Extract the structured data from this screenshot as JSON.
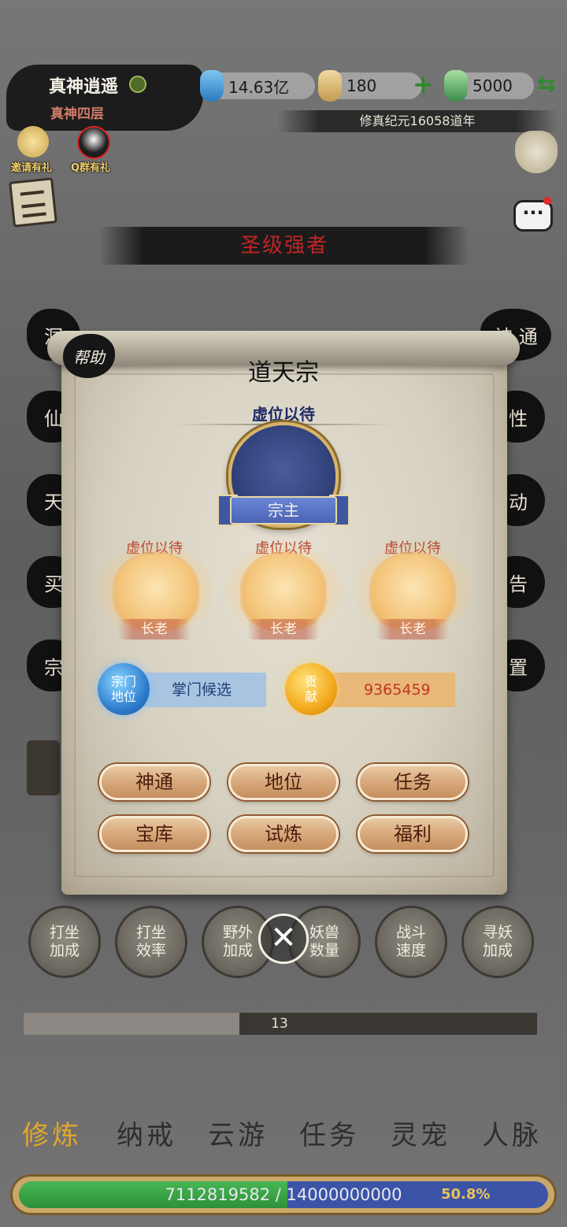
{
  "player": {
    "name": "真神逍遥",
    "level": "真神四层"
  },
  "resources": {
    "spirit_stones": "14.63亿",
    "gourd": "180",
    "add_symbol": "+",
    "jade": "5000",
    "swap_symbol": "⇆"
  },
  "era": "修真纪元16058道年",
  "badges": {
    "invite": "邀请有礼",
    "qq_group": "Q群有礼"
  },
  "title_banner": "圣级强者",
  "side_left": [
    "洞",
    "仙",
    "天",
    "买",
    "宗"
  ],
  "side_right": [
    "神 通",
    "性",
    "动",
    "告",
    "置"
  ],
  "modal": {
    "help": "帮助",
    "sect_name": "道天宗",
    "leader": {
      "status": "虚位以待",
      "role": "宗主"
    },
    "elders": [
      {
        "status": "虚位以待",
        "role": "长老"
      },
      {
        "status": "虚位以待",
        "role": "长老"
      },
      {
        "status": "虚位以待",
        "role": "长老"
      }
    ],
    "position": {
      "orb_label": "宗门\n地位",
      "value": "掌门候选"
    },
    "contribution": {
      "orb_label": "贡\n献",
      "value": "9365459"
    },
    "buttons": [
      "神通",
      "地位",
      "任务",
      "宝库",
      "试炼",
      "福利"
    ]
  },
  "close_symbol": "✕",
  "boosts": [
    "打坐\n加成",
    "打坐\n效率",
    "野外\n加成",
    "妖兽\n数量",
    "战斗\n速度",
    "寻妖\n加成"
  ],
  "progress": {
    "label": "13",
    "fraction": 0.42
  },
  "tabs": [
    "修炼",
    "纳戒",
    "云游",
    "任务",
    "灵宠",
    "人脉"
  ],
  "active_tab": 0,
  "exp": {
    "current": "7112819582",
    "separator": " / ",
    "max": "14000000000",
    "percent": "50.8%",
    "fraction": 0.508
  },
  "colors": {
    "accent_gold": "#e2a72c",
    "banner_red": "#c02525",
    "exp_green": "#2f8f3a",
    "exp_blue": "#3c54a8"
  }
}
